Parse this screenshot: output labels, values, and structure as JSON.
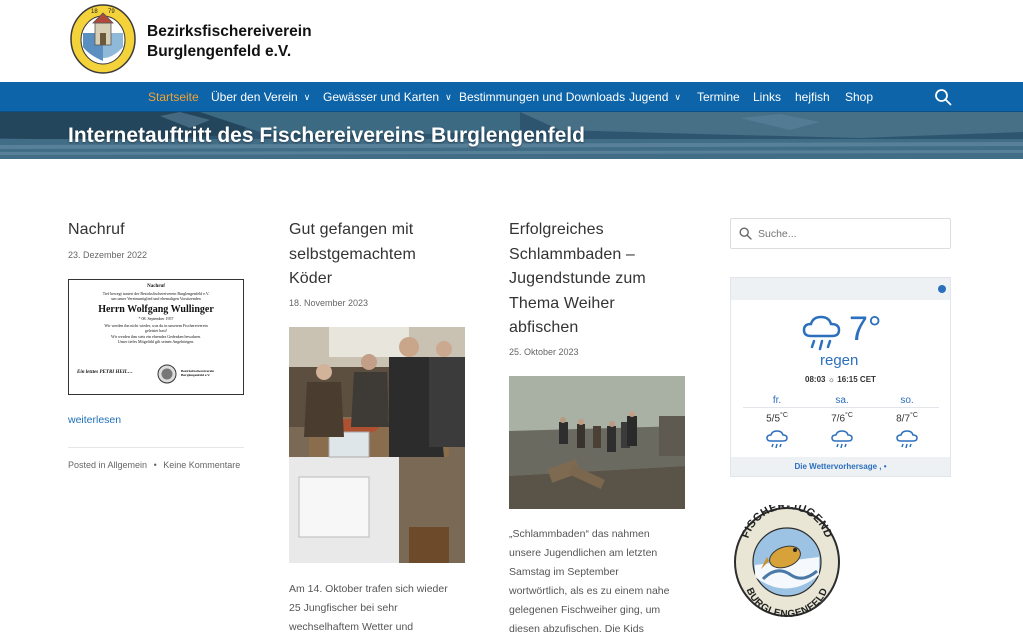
{
  "site": {
    "name_line1": "Bezirksfischereiverein",
    "name_line2": "Burglengenfeld e.V.",
    "logo_year_left": "18",
    "logo_year_right": "79"
  },
  "nav": {
    "items": [
      {
        "label": "Startseite",
        "active": true
      },
      {
        "label": "Über den Verein",
        "dropdown": true
      },
      {
        "label": "Gewässer und Karten",
        "dropdown": true
      },
      {
        "label": "Bestimmungen und Downloads"
      },
      {
        "label": "Jugend",
        "dropdown": true
      },
      {
        "label": "Termine"
      },
      {
        "label": "Links"
      },
      {
        "label": "hejfish"
      },
      {
        "label": "Shop"
      }
    ],
    "caret": "∨",
    "active_color": "#f2a333",
    "bar_color": "#0d64a8"
  },
  "hero": {
    "title": "Internetauftritt des Fischereivereins Burglengenfeld"
  },
  "posts": [
    {
      "title": "Nachruf",
      "date": "23. Dezember 2022",
      "readmore": "weiterlesen",
      "category_prefix": "Posted in",
      "category": "Allgemein",
      "separator": "•",
      "comments": "Keine Kommentare",
      "card": {
        "heading": "Nachruf",
        "line1": "Tief bewegt trauert der Bezirksfischereiverein Burglengenfeld e.V.",
        "line2": "um unser Vereinsmitglied und ehemaligen Vorsitzenden",
        "name": "Herrn Wolfgang Wullinger",
        "birth": "* 08. September 1957",
        "text1": "Wir werden ihn nicht wieder, was du in unserem Fischereiverein",
        "text2": "geleistet hast!",
        "text3": "Wir werden ihm stets ein ehrendes Gedenken bewahren.",
        "text4": "Unser tiefes Mitgefühl gilt seinen Angehörigen.",
        "closing": "Ein letztes PETRI HEIL…",
        "org": "Bezirksfischereiverein Burglengenfeld e.V."
      }
    },
    {
      "title_lines": [
        "Gut gefangen mit",
        "selbstgemachtem",
        "Köder"
      ],
      "date": "18. November 2023",
      "excerpt_lines": [
        "Am 14. Oktober trafen sich wieder",
        "25 Jungfischer bei sehr",
        "wechselhaftem Wetter und"
      ]
    },
    {
      "title_lines": [
        "Erfolgreiches",
        "Schlammbaden –",
        "Jugendstunde zum",
        "Thema Weiher",
        "abfischen"
      ],
      "date": "25. Oktober 2023",
      "excerpt_lines": [
        "„Schlammbaden“ das nahmen",
        "unsere Jugendlichen am letzten",
        "Samstag im September",
        "wortwörtlich, als es zu einem nahe",
        "gelegenen Fischweiher ging, um",
        "diesen abzufischen. Die Kids"
      ]
    }
  ],
  "sidebar": {
    "search_placeholder": "Suche...",
    "weather": {
      "temp": "7°",
      "desc": "regen",
      "sun": "08:03 ☼ 16:15 CET",
      "days": [
        {
          "day": "fr.",
          "hi": "5",
          "lo": "5",
          "unit": "°C"
        },
        {
          "day": "sa.",
          "hi": "7",
          "lo": "6",
          "unit": "°C"
        },
        {
          "day": "so.",
          "hi": "8",
          "lo": "7",
          "unit": "°C"
        }
      ],
      "footer": "Die Wettervorhersage , •",
      "accent": "#2b6fbd"
    },
    "badge": {
      "top": "FISCHER-JUGEND",
      "bottom": "BURGLENGENFELD"
    }
  }
}
